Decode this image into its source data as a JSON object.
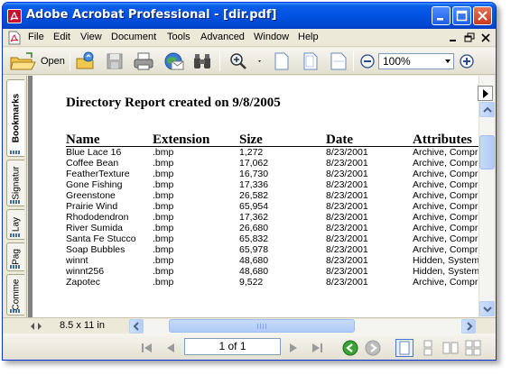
{
  "window": {
    "title": "Adobe Acrobat Professional - [dir.pdf]"
  },
  "menu": {
    "items": [
      "File",
      "Edit",
      "View",
      "Document",
      "Tools",
      "Advanced",
      "Window",
      "Help"
    ]
  },
  "toolbar": {
    "open_label": "Open",
    "zoom_value": "100%"
  },
  "navpane": {
    "tabs": [
      "Bookmarks",
      "Signatur",
      "Lay",
      "Pag",
      "Comme"
    ],
    "active_tab": "Bookmarks"
  },
  "document": {
    "heading": "Directory Report created on 9/8/2005",
    "columns": [
      "Name",
      "Extension",
      "Size",
      "Date",
      "Attributes"
    ],
    "rows": [
      [
        "Blue Lace 16",
        ".bmp",
        "1,272",
        "8/23/2001",
        "Archive, Compr"
      ],
      [
        "Coffee Bean",
        ".bmp",
        "17,062",
        "8/23/2001",
        "Archive, Compr"
      ],
      [
        "FeatherTexture",
        ".bmp",
        "16,730",
        "8/23/2001",
        "Archive, Compr"
      ],
      [
        "Gone Fishing",
        ".bmp",
        "17,336",
        "8/23/2001",
        "Archive, Compr"
      ],
      [
        "Greenstone",
        ".bmp",
        "26,582",
        "8/23/2001",
        "Archive, Compr"
      ],
      [
        "Prairie Wind",
        ".bmp",
        "65,954",
        "8/23/2001",
        "Archive, Compr"
      ],
      [
        "Rhododendron",
        ".bmp",
        "17,362",
        "8/23/2001",
        "Archive, Compr"
      ],
      [
        "River Sumida",
        ".bmp",
        "26,680",
        "8/23/2001",
        "Archive, Compr"
      ],
      [
        "Santa Fe Stucco",
        ".bmp",
        "65,832",
        "8/23/2001",
        "Archive, Compr"
      ],
      [
        "Soap Bubbles",
        ".bmp",
        "65,978",
        "8/23/2001",
        "Archive, Compr"
      ],
      [
        "winnt",
        ".bmp",
        "48,680",
        "8/23/2001",
        "Hidden, System"
      ],
      [
        "winnt256",
        ".bmp",
        "48,680",
        "8/23/2001",
        "Hidden, System"
      ],
      [
        "Zapotec",
        ".bmp",
        "9,522",
        "8/23/2001",
        "Archive, Compr"
      ]
    ]
  },
  "status": {
    "page_size": "8.5 x 11 in",
    "page_indicator": "1 of 1"
  },
  "colors": {
    "titlebar": "#0054e3",
    "chrome": "#ece9d8",
    "scroll_thumb": "#b4cdf6",
    "go_green": "#3aa335"
  },
  "icons": {
    "titlebar": [
      "acrobat-app-icon",
      "minimize-icon",
      "maximize-icon",
      "close-icon"
    ],
    "toolbar": [
      "open-folder-icon",
      "organizer-icon",
      "save-icon",
      "print-icon",
      "email-icon",
      "search-binoculars-icon",
      "zoom-in-tool-icon",
      "actual-size-icon",
      "fit-page-icon",
      "fit-width-icon",
      "zoom-out-icon",
      "zoom-in-icon"
    ],
    "navigation": [
      "first-page-icon",
      "previous-page-icon",
      "next-page-icon",
      "last-page-icon",
      "go-back-icon",
      "go-forward-icon",
      "single-page-icon",
      "continuous-icon",
      "facing-icon",
      "continuous-facing-icon"
    ]
  }
}
